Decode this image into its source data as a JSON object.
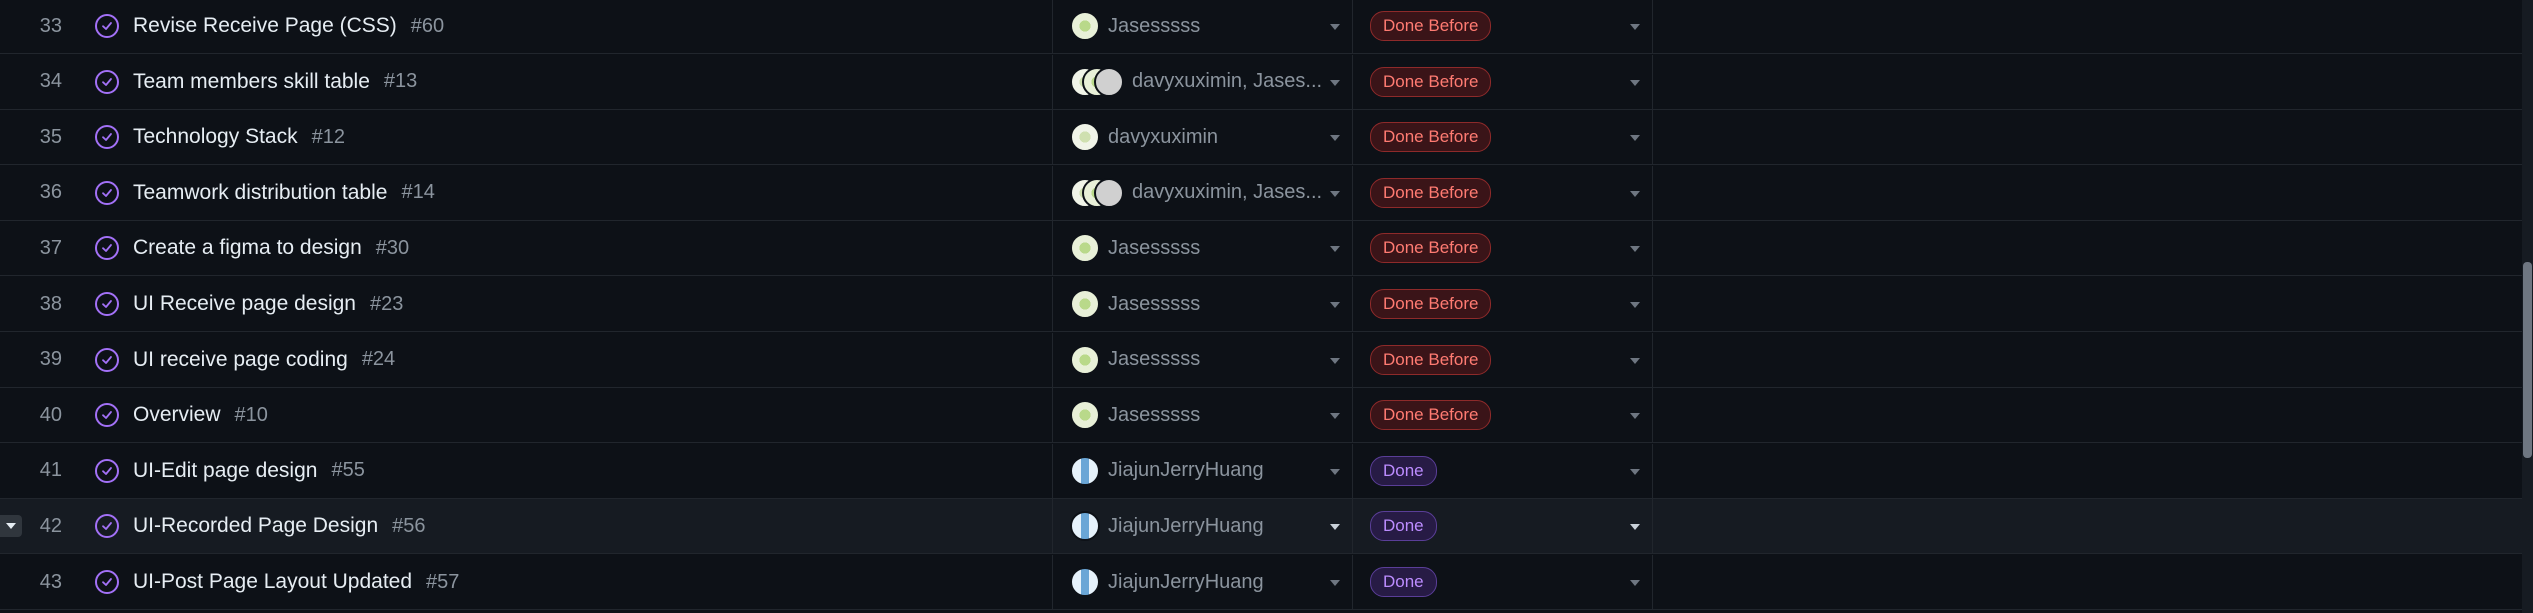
{
  "rows": [
    {
      "num": "33",
      "title": "Revise Receive Page (CSS)",
      "issue": "#60",
      "assignee": "Jasesssss",
      "avatars": [
        "jas"
      ],
      "status": "Done Before",
      "status_kind": "before"
    },
    {
      "num": "34",
      "title": "Team members skill table",
      "issue": "#13",
      "assignee": "davyxuximin, Jases...",
      "avatars": [
        "davy",
        "jas",
        "gray"
      ],
      "status": "Done Before",
      "status_kind": "before"
    },
    {
      "num": "35",
      "title": "Technology Stack",
      "issue": "#12",
      "assignee": "davyxuximin",
      "avatars": [
        "davy"
      ],
      "status": "Done Before",
      "status_kind": "before"
    },
    {
      "num": "36",
      "title": "Teamwork distribution table",
      "issue": "#14",
      "assignee": "davyxuximin, Jases...",
      "avatars": [
        "davy",
        "jas",
        "gray"
      ],
      "status": "Done Before",
      "status_kind": "before"
    },
    {
      "num": "37",
      "title": "Create a figma to design",
      "issue": "#30",
      "assignee": "Jasesssss",
      "avatars": [
        "jas"
      ],
      "status": "Done Before",
      "status_kind": "before"
    },
    {
      "num": "38",
      "title": "UI Receive page design",
      "issue": "#23",
      "assignee": "Jasesssss",
      "avatars": [
        "jas"
      ],
      "status": "Done Before",
      "status_kind": "before"
    },
    {
      "num": "39",
      "title": "UI receive page coding",
      "issue": "#24",
      "assignee": "Jasesssss",
      "avatars": [
        "jas"
      ],
      "status": "Done Before",
      "status_kind": "before"
    },
    {
      "num": "40",
      "title": "Overview",
      "issue": "#10",
      "assignee": "Jasesssss",
      "avatars": [
        "jas"
      ],
      "status": "Done Before",
      "status_kind": "before"
    },
    {
      "num": "41",
      "title": "UI-Edit page design",
      "issue": "#55",
      "assignee": "JiajunJerryHuang",
      "avatars": [
        "jerry"
      ],
      "status": "Done",
      "status_kind": "done"
    },
    {
      "num": "42",
      "title": "UI-Recorded Page Design",
      "issue": "#56",
      "assignee": "JiajunJerryHuang",
      "avatars": [
        "jerry"
      ],
      "status": "Done",
      "status_kind": "done",
      "hover": true
    },
    {
      "num": "43",
      "title": "UI-Post Page Layout Updated",
      "issue": "#57",
      "assignee": "JiajunJerryHuang",
      "avatars": [
        "jerry"
      ],
      "status": "Done",
      "status_kind": "done"
    }
  ],
  "icons": {
    "row_status": "circle-check-icon",
    "dropdown": "caret-down-icon",
    "row_menu": "row-menu-icon"
  },
  "colors": {
    "background": "#0d1117",
    "done_before_text": "#ff7b72",
    "done_text": "#bc8cff",
    "status_icon": "#a371f7"
  }
}
